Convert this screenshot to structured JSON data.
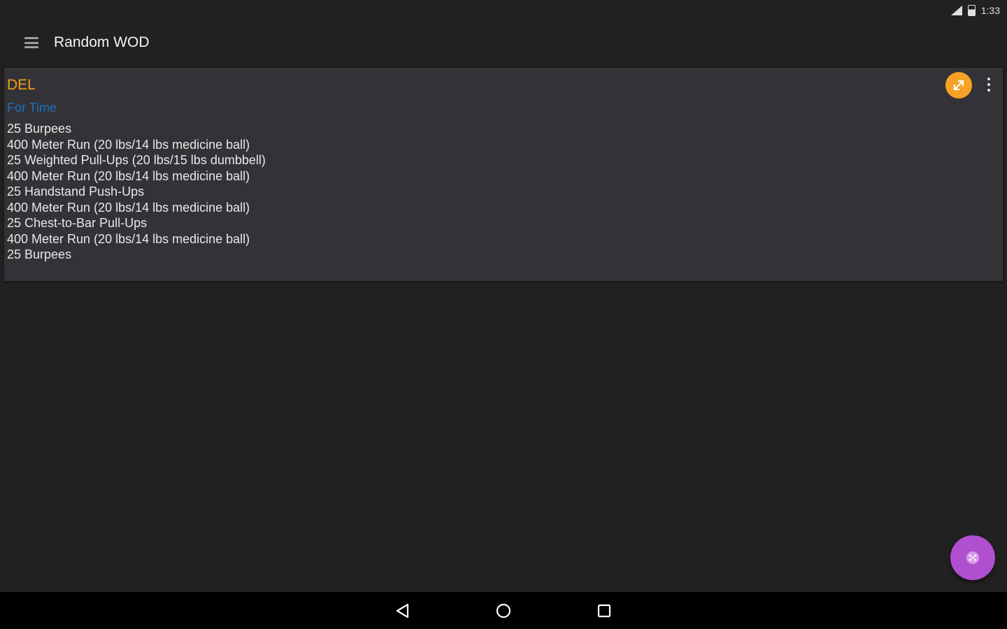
{
  "status_bar": {
    "time": "1:33",
    "icons": [
      "signal-icon",
      "battery-icon"
    ]
  },
  "app_bar": {
    "title": "Random WOD",
    "menu_icon": "hamburger-menu-icon"
  },
  "workout": {
    "name": "DEL",
    "type": "For Time",
    "movements": [
      "25 Burpees",
      "400 Meter Run (20 lbs/14 lbs medicine ball)",
      "25 Weighted Pull-Ups (20 lbs/15 lbs dumbbell)",
      "400 Meter Run (20 lbs/14 lbs medicine ball)",
      "25 Handstand Push-Ups",
      "400 Meter Run (20 lbs/14 lbs medicine ball)",
      "25 Chest-to-Bar Pull-Ups",
      "400 Meter Run (20 lbs/14 lbs medicine ball)",
      "25 Burpees"
    ],
    "actions": {
      "expand_icon": "expand-arrows-icon",
      "overflow_icon": "more-vert-icon"
    }
  },
  "fab": {
    "icon": "dice-icon"
  },
  "nav_bar": {
    "buttons": [
      "back-icon",
      "home-icon",
      "recents-icon"
    ]
  },
  "colors": {
    "background": "#212121",
    "card": "#333337",
    "wod_name": "#f39c12",
    "wod_type": "#1f6fbf",
    "accent_orange": "#f7a126",
    "fab": "#b04fd0"
  }
}
